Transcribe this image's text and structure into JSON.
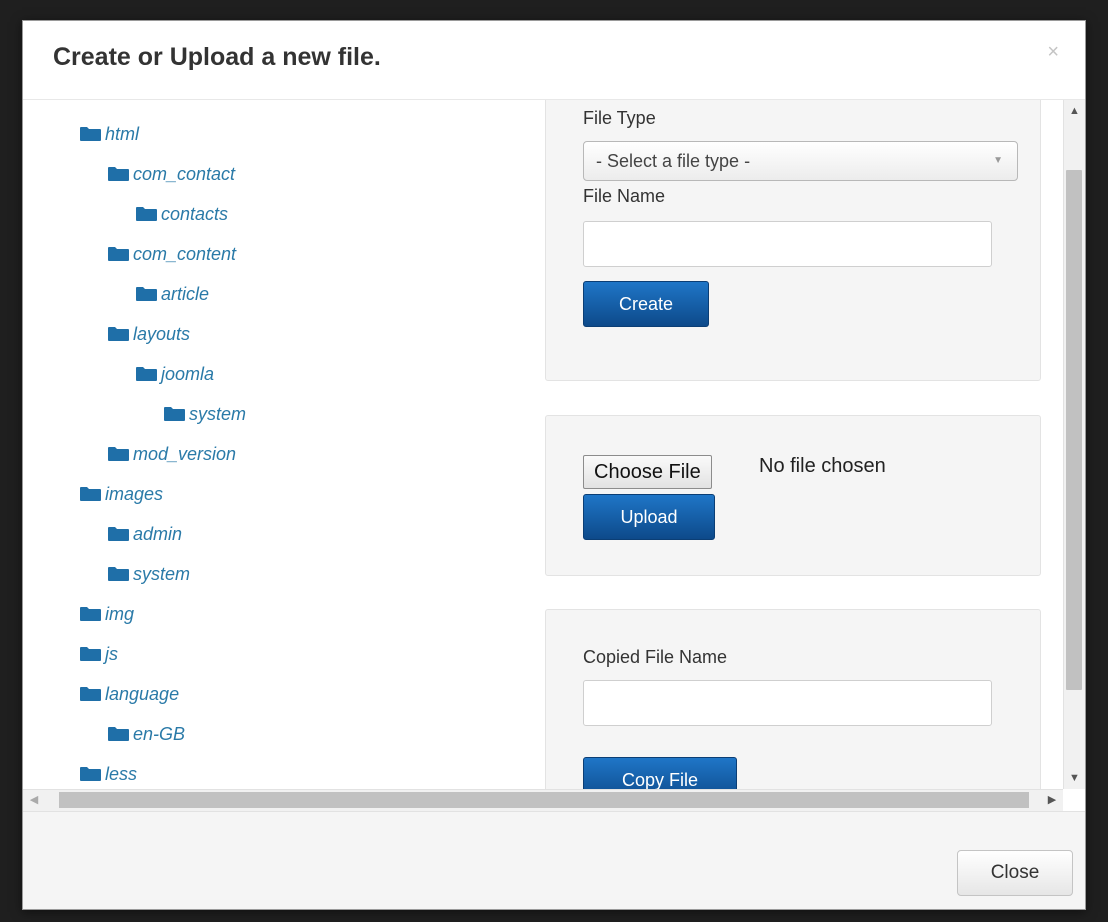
{
  "modal": {
    "title": "Create or Upload a new file.",
    "close_symbol": "×"
  },
  "tree": {
    "items": [
      {
        "label": "html",
        "depth": 0
      },
      {
        "label": "com_contact",
        "depth": 1
      },
      {
        "label": "contacts",
        "depth": 2
      },
      {
        "label": "com_content",
        "depth": 1
      },
      {
        "label": "article",
        "depth": 2
      },
      {
        "label": "layouts",
        "depth": 1
      },
      {
        "label": "joomla",
        "depth": 2
      },
      {
        "label": "system",
        "depth": 3
      },
      {
        "label": "mod_version",
        "depth": 1
      },
      {
        "label": "images",
        "depth": 0
      },
      {
        "label": "admin",
        "depth": 1
      },
      {
        "label": "system",
        "depth": 1
      },
      {
        "label": "img",
        "depth": 0
      },
      {
        "label": "js",
        "depth": 0
      },
      {
        "label": "language",
        "depth": 0
      },
      {
        "label": "en-GB",
        "depth": 1
      },
      {
        "label": "less",
        "depth": 0
      }
    ],
    "icon": "folder-icon",
    "color": "#2a7aa8"
  },
  "create_panel": {
    "file_type_label": "File Type",
    "file_type_selected": "- Select a file type -",
    "file_name_label": "File Name",
    "file_name_value": "",
    "create_button": "Create"
  },
  "upload_panel": {
    "choose_button": "Choose File",
    "no_file_text": "No file chosen",
    "upload_button": "Upload"
  },
  "copy_panel": {
    "copied_name_label": "Copied File Name",
    "copied_name_value": "",
    "copy_button": "Copy File"
  },
  "footer": {
    "close_button": "Close"
  },
  "scrollbars": {
    "up": "▲",
    "down": "▼",
    "left": "◀",
    "right": "▶"
  },
  "colors": {
    "primary_button": "#1a65b0",
    "link": "#2a7aa8"
  }
}
